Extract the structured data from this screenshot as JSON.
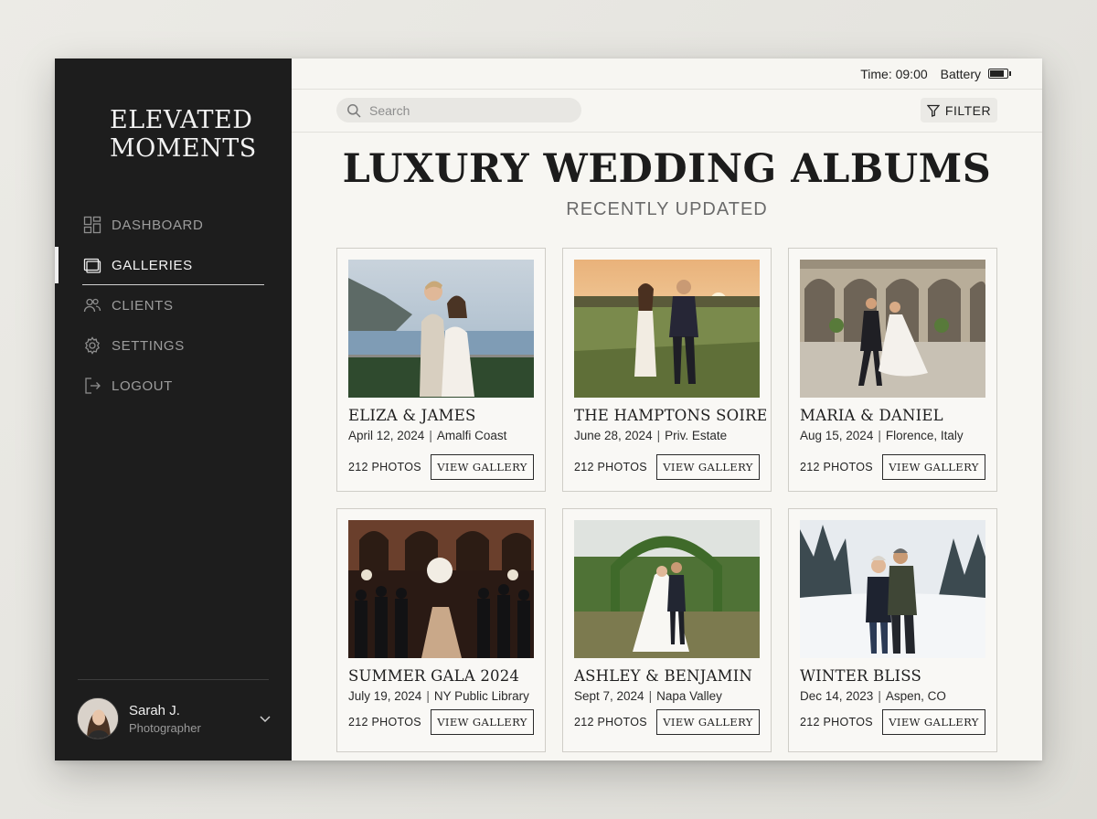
{
  "brand": {
    "line1": "ELEVATED",
    "line2": "MOMENTS"
  },
  "nav": [
    {
      "label": "DASHBOARD",
      "icon": "dashboard-icon",
      "active": false
    },
    {
      "label": "GALLERIES",
      "icon": "galleries-icon",
      "active": true
    },
    {
      "label": "CLIENTS",
      "icon": "clients-icon",
      "active": false
    },
    {
      "label": "SETTINGS",
      "icon": "gear-icon",
      "active": false
    },
    {
      "label": "LOGOUT",
      "icon": "logout-icon",
      "active": false
    }
  ],
  "profile": {
    "name": "Sarah J.",
    "role": "Photographer"
  },
  "status": {
    "time": "Time: 09:00",
    "battery_label": "Battery",
    "battery_level": 0.85
  },
  "search": {
    "placeholder": "Search"
  },
  "filter": {
    "label": "FILTER"
  },
  "page": {
    "title": "LUXURY WEDDING ALBUMS",
    "subtitle": "RECENTLY UPDATED"
  },
  "albums": [
    {
      "title": "ELIZA & JAMES",
      "date": "April 12, 2024",
      "location": "Amalfi Coast",
      "photos": "212 PHOTOS",
      "button": "VIEW GALLERY"
    },
    {
      "title": "THE HAMPTONS SOIREE",
      "date": "June 28, 2024",
      "location": "Priv. Estate",
      "photos": "212 PHOTOS",
      "button": "VIEW GALLERY"
    },
    {
      "title": "MARIA & DANIEL",
      "date": "Aug 15, 2024",
      "location": "Florence, Italy",
      "photos": "212 PHOTOS",
      "button": "VIEW GALLERY"
    },
    {
      "title": "SUMMER GALA 2024",
      "date": "July 19, 2024",
      "location": "NY Public Library",
      "photos": "212 PHOTOS",
      "button": "VIEW GALLERY"
    },
    {
      "title": "ASHLEY & BENJAMIN",
      "date": "Sept 7, 2024",
      "location": "Napa Valley",
      "photos": "212 PHOTOS",
      "button": "VIEW GALLERY"
    },
    {
      "title": "WINTER BLISS",
      "date": "Dec 14, 2023",
      "location": "Aspen, CO",
      "photos": "212 PHOTOS",
      "button": "VIEW GALLERY"
    }
  ],
  "colors": {
    "sidebar": "#1d1d1d",
    "main_bg": "#f7f6f2",
    "accent_text": "#1c1c1c"
  }
}
